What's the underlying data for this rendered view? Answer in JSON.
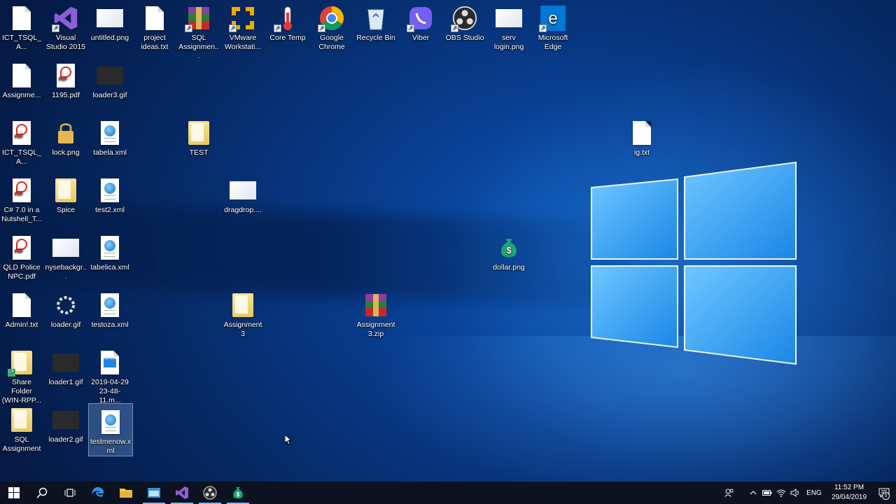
{
  "desktop": {
    "icons": [
      {
        "label": "ICT_TSQL_A...",
        "icon": "text-document-icon"
      },
      {
        "label": "Visual Studio 2015",
        "icon": "visual-studio-icon"
      },
      {
        "label": "untitled.png",
        "icon": "image-thumbnail-icon"
      },
      {
        "label": "project ideas.txt",
        "icon": "text-file-icon"
      },
      {
        "label": "SQL Assignmen...",
        "icon": "winrar-archive-icon"
      },
      {
        "label": "VMware Workstati...",
        "icon": "vmware-icon"
      },
      {
        "label": "Core Temp",
        "icon": "thermometer-icon"
      },
      {
        "label": "Google Chrome",
        "icon": "chrome-icon"
      },
      {
        "label": "Recycle Bin",
        "icon": "recycle-bin-icon"
      },
      {
        "label": "Viber",
        "icon": "viber-icon"
      },
      {
        "label": "OBS Studio",
        "icon": "obs-icon"
      },
      {
        "label": "serv login.png",
        "icon": "image-thumbnail-icon"
      },
      {
        "label": "Microsoft Edge",
        "icon": "edge-icon"
      },
      {
        "label": "Assignme...",
        "icon": "text-file-icon"
      },
      {
        "label": "1195.pdf",
        "icon": "pdf-icon"
      },
      {
        "label": "loader3.gif",
        "icon": "gif-thumbnail-icon"
      },
      {
        "label": "ICT_TSQL_A...",
        "icon": "pdf-icon"
      },
      {
        "label": "lock.png",
        "icon": "lock-icon"
      },
      {
        "label": "tabela.xml",
        "icon": "xml-file-icon"
      },
      {
        "label": "TEST",
        "icon": "folder-icon"
      },
      {
        "label": "ig.txt",
        "icon": "text-file-icon"
      },
      {
        "label": "C# 7.0 in a Nutshell_T...",
        "icon": "pdf-icon"
      },
      {
        "label": "Spice",
        "icon": "folder-icon"
      },
      {
        "label": "test2.xml",
        "icon": "xml-file-icon"
      },
      {
        "label": "dragdrop....",
        "icon": "image-thumbnail-icon"
      },
      {
        "label": "QLD Police NPC.pdf",
        "icon": "pdf-icon"
      },
      {
        "label": "nysebackgr...",
        "icon": "image-thumbnail-icon"
      },
      {
        "label": "tabelica.xml",
        "icon": "xml-file-icon"
      },
      {
        "label": "dollar.png",
        "icon": "dollar-bag-icon"
      },
      {
        "label": "Admin!.txt",
        "icon": "text-file-icon"
      },
      {
        "label": "loader.gif",
        "icon": "spinner-icon"
      },
      {
        "label": "testoza.xml",
        "icon": "xml-file-icon"
      },
      {
        "label": "Assignment 3",
        "icon": "folder-icon"
      },
      {
        "label": "Assignment 3.zip",
        "icon": "winrar-archive-icon"
      },
      {
        "label": "Share Folder (WIN-RPP...",
        "icon": "share-folder-icon"
      },
      {
        "label": "loader1.gif",
        "icon": "gif-thumbnail-icon"
      },
      {
        "label": "2019-04-29 23-48-11.m...",
        "icon": "video-file-icon"
      },
      {
        "label": "SQL Assignment",
        "icon": "folder-icon"
      },
      {
        "label": "loader2.gif",
        "icon": "gif-thumbnail-icon"
      },
      {
        "label": "testmenow.xml",
        "icon": "xml-file-icon",
        "selected": true
      }
    ]
  },
  "taskbar": {
    "items": [
      {
        "name": "start-button",
        "icon": "windows-icon"
      },
      {
        "name": "search-button",
        "icon": "search-icon"
      },
      {
        "name": "task-view-button",
        "icon": "task-view-icon"
      },
      {
        "name": "taskbar-edge",
        "icon": "edge-icon"
      },
      {
        "name": "taskbar-file-explorer",
        "icon": "folder-icon"
      },
      {
        "name": "taskbar-app-window",
        "icon": "window-icon"
      },
      {
        "name": "taskbar-visual-studio",
        "icon": "visual-studio-icon"
      },
      {
        "name": "taskbar-obs",
        "icon": "obs-icon"
      },
      {
        "name": "taskbar-dollar",
        "icon": "dollar-bag-icon"
      }
    ],
    "tray": {
      "language": "ENG",
      "time": "11:52 PM",
      "date": "29/04/2019",
      "notifications": "5"
    }
  },
  "colors": {
    "taskbar": "#0c121e",
    "accent": "#76b9ed",
    "wallpaper": "#0b56b8"
  }
}
